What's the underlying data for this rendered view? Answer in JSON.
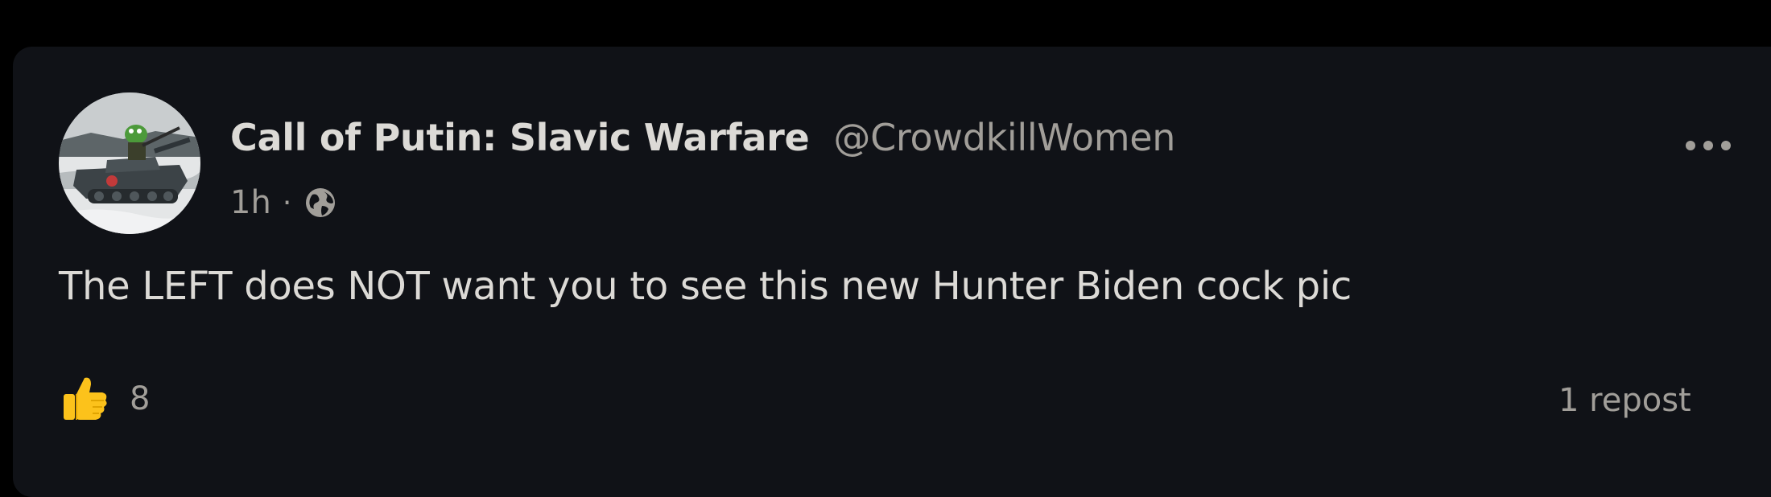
{
  "post": {
    "author": {
      "display_name": "Call of Putin: Slavic Warfare",
      "handle": "@CrowdkillWomen",
      "avatar_icon": "tank-avatar-icon"
    },
    "time": "1h",
    "separator": "·",
    "visibility_icon": "globe-icon",
    "menu_icon": "more-options-icon",
    "text": "The LEFT does NOT want you to see this new Hunter Biden cock pic",
    "reactions": {
      "icon": "thumbs-up-icon",
      "count": "8"
    },
    "repost_label": "1 repost"
  },
  "colors": {
    "page_background": "#000000",
    "card_background": "#101217",
    "primary_text": "#dcdad6",
    "secondary_text": "#a19e99",
    "reaction_yellow": "#fcc21b"
  }
}
